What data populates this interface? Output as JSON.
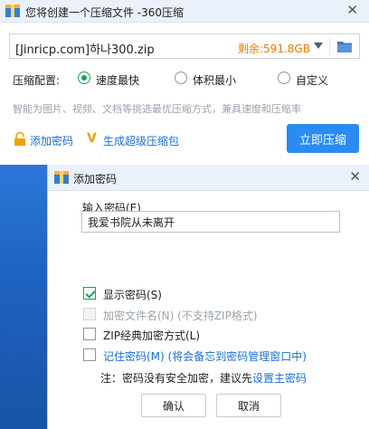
{
  "main_window": {
    "title": "您将创建一个压缩文件 -360压缩",
    "archive_path": "[Jinricp.com]하나300.zip",
    "space_left": "剩余:591.8GB",
    "config_label": "压缩配置:",
    "modes": [
      {
        "label": "速度最快",
        "selected": true
      },
      {
        "label": "体积最小",
        "selected": false
      },
      {
        "label": "自定义",
        "selected": false
      }
    ],
    "description": "智能为图片、视频、文档等挑选最优压缩方式，兼具速度和压缩率",
    "add_password_link": "添加密码",
    "super_archive_link": "生成超级压缩包",
    "compress_button": "立即压缩"
  },
  "password_dialog": {
    "title": "添加密码",
    "input_label": "输入密码(E)",
    "password_value": "我爱书院从未离开",
    "options": [
      {
        "label": "显示密码(S)",
        "checked": true,
        "disabled": false,
        "style": "normal"
      },
      {
        "label": "加密文件名(N) (不支持ZIP格式)",
        "checked": false,
        "disabled": true,
        "style": "normal"
      },
      {
        "label": "ZIP经典加密方式(L)",
        "checked": false,
        "disabled": false,
        "style": "normal"
      },
      {
        "label": "记住密码(M) (将会备忘到密码管理窗口中)",
        "checked": false,
        "disabled": false,
        "style": "link"
      }
    ],
    "note_text": "注：密码没有安全加密，建议先",
    "note_link": "设置主密码",
    "ok_button": "确认",
    "cancel_button": "取消"
  },
  "icons": {
    "app_icon": "archive-box-icon",
    "close": "close-icon",
    "dropdown": "chevron-down-icon",
    "folder": "folder-icon",
    "lock": "lock-icon",
    "vip": "vip-v-icon"
  },
  "colors": {
    "accent": "#2a8bf2",
    "link": "#1a6fd1",
    "checked": "#1aa15a",
    "space_left": "#ef7a00"
  }
}
